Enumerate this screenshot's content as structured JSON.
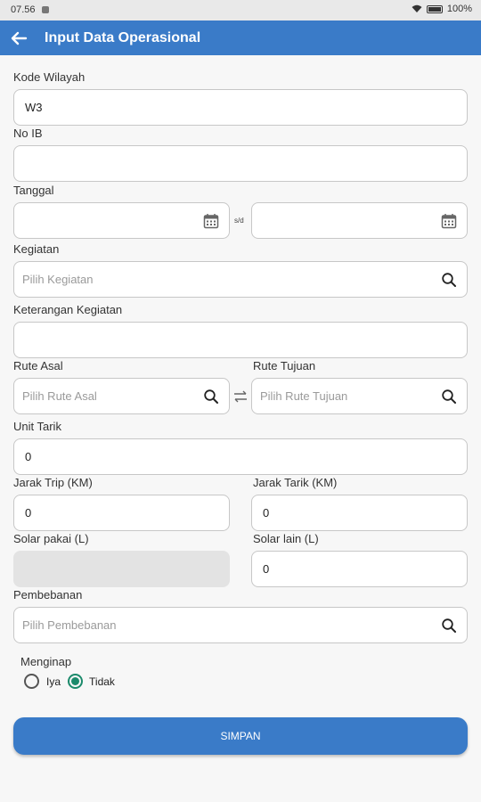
{
  "status_bar": {
    "time": "07.56",
    "battery": "100%"
  },
  "header": {
    "title": "Input Data Operasional"
  },
  "form": {
    "kode_wilayah": {
      "label": "Kode Wilayah",
      "value": "W3"
    },
    "no_ib": {
      "label": "No IB",
      "value": ""
    },
    "tanggal": {
      "label": "Tanggal",
      "separator": "s/d",
      "start": "",
      "end": ""
    },
    "kegiatan": {
      "label": "Kegiatan",
      "placeholder": "Pilih Kegiatan"
    },
    "keterangan_kegiatan": {
      "label": "Keterangan Kegiatan",
      "value": ""
    },
    "rute_asal": {
      "label": "Rute Asal",
      "placeholder": "Pilih Rute Asal"
    },
    "rute_tujuan": {
      "label": "Rute Tujuan",
      "placeholder": "Pilih Rute Tujuan"
    },
    "unit_tarik": {
      "label": "Unit Tarik",
      "value": "0"
    },
    "jarak_trip": {
      "label": "Jarak Trip (KM)",
      "value": "0"
    },
    "jarak_tarik": {
      "label": "Jarak Tarik (KM)",
      "value": "0"
    },
    "solar_pakai": {
      "label": "Solar pakai (L)",
      "value": ""
    },
    "solar_lain": {
      "label": "Solar lain (L)",
      "value": "0"
    },
    "pembebanan": {
      "label": "Pembebanan",
      "placeholder": "Pilih Pembebanan"
    },
    "menginap": {
      "label": "Menginap",
      "options": [
        "Iya",
        "Tidak"
      ],
      "selected": "Tidak"
    }
  },
  "submit": {
    "label": "SIMPAN"
  },
  "colors": {
    "primary": "#3a7bc8",
    "radio_selected": "#1b8a6b"
  }
}
